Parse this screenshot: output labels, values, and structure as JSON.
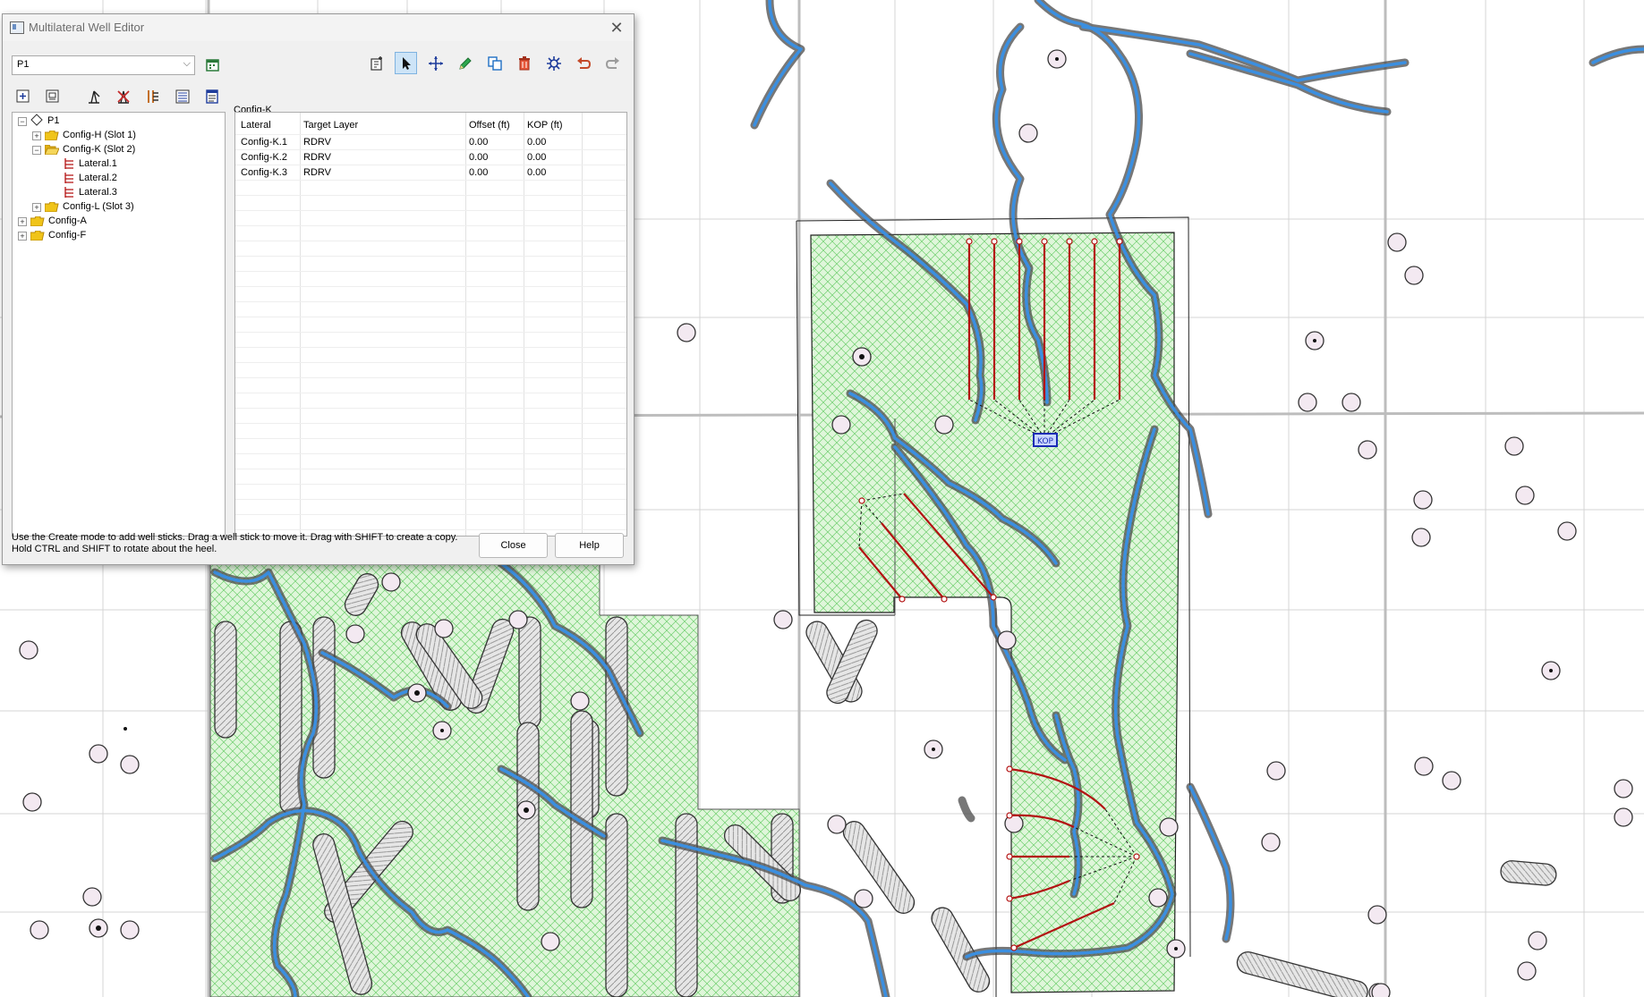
{
  "window": {
    "title": "Multilateral Well Editor",
    "close_glyph": "✕"
  },
  "well_select": {
    "value": "P1",
    "arrow": "⌵"
  },
  "group_label": "Config-K",
  "tree": {
    "root": "P1",
    "items": [
      {
        "label": "Config-H (Slot 1)",
        "expander": "+"
      },
      {
        "label": "Config-K (Slot 2)",
        "expander": "−"
      },
      {
        "label": "Lateral.1"
      },
      {
        "label": "Lateral.2"
      },
      {
        "label": "Lateral.3"
      },
      {
        "label": "Config-L (Slot 3)",
        "expander": "+"
      },
      {
        "label": "Config-A",
        "expander": "+"
      },
      {
        "label": "Config-F",
        "expander": "+"
      }
    ],
    "root_expander": "−"
  },
  "table": {
    "columns": [
      "Lateral",
      "Target Layer",
      "Offset (ft)",
      "KOP (ft)"
    ],
    "rows": [
      [
        "Config-K.1",
        "RDRV",
        "0.00",
        "0.00"
      ],
      [
        "Config-K.2",
        "RDRV",
        "0.00",
        "0.00"
      ],
      [
        "Config-K.3",
        "RDRV",
        "0.00",
        "0.00"
      ]
    ]
  },
  "help_text": {
    "line1": "Use the Create mode to add well sticks. Drag a well stick to move it. Drag with SHIFT to create a copy.",
    "line2": "Hold CTRL and SHIFT to rotate about the heel."
  },
  "buttons": {
    "close": "Close",
    "help": "Help"
  },
  "map": {
    "kop_label": "KOP"
  },
  "colors": {
    "lateral": "#b31212",
    "river": "#3b8fe0",
    "lease_fill": "#d9f5d4",
    "hatch": "#55c255"
  }
}
